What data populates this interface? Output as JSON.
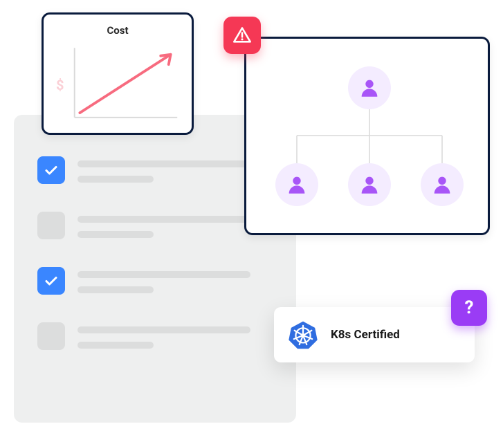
{
  "cost_card": {
    "title": "Cost",
    "currency_symbol": "$"
  },
  "chart_data": {
    "type": "line",
    "title": "Cost",
    "xlabel": "",
    "ylabel": "$",
    "x": [
      0,
      10
    ],
    "values": [
      1,
      9
    ],
    "xlim": [
      0,
      10
    ],
    "ylim": [
      0,
      10
    ]
  },
  "checklist": {
    "items": [
      {
        "checked": true
      },
      {
        "checked": false
      },
      {
        "checked": true
      },
      {
        "checked": false
      }
    ]
  },
  "k8s": {
    "label": "K8s Certified"
  },
  "badges": {
    "alert_icon": "alert-triangle-icon",
    "help_label": "?"
  },
  "colors": {
    "blue": "#3a86ff",
    "red": "#f53855",
    "purple": "#9a3cf5",
    "k8s_blue": "#2f6de0",
    "person_fill": "#a855f7",
    "person_bg": "#f4ecff",
    "card_border": "#0a1b3d",
    "grey_bg": "#eeefef",
    "grey_line": "#dcdddd"
  }
}
